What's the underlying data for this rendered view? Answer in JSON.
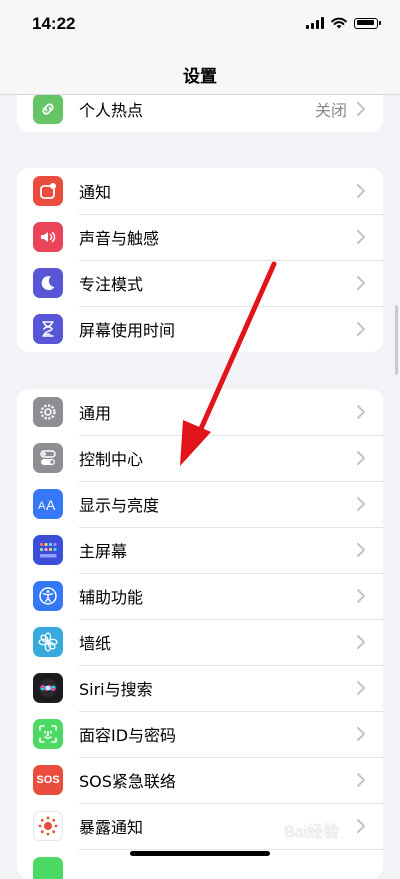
{
  "status_bar": {
    "time": "14:22"
  },
  "header": {
    "title": "设置"
  },
  "groups": [
    {
      "items": [
        {
          "label": "个人热点",
          "value": "关闭",
          "icon": "hotspot-icon",
          "color": "#65c466"
        }
      ]
    },
    {
      "items": [
        {
          "label": "通知",
          "icon": "notification-icon",
          "color": "#eb4d3d"
        },
        {
          "label": "声音与触感",
          "icon": "sound-icon",
          "color": "#eb445a"
        },
        {
          "label": "专注模式",
          "icon": "moon-icon",
          "color": "#5856d6"
        },
        {
          "label": "屏幕使用时间",
          "icon": "hourglass-icon",
          "color": "#5856d6"
        }
      ]
    },
    {
      "items": [
        {
          "label": "通用",
          "icon": "gear-icon",
          "color": "#8e8e93"
        },
        {
          "label": "控制中心",
          "icon": "toggles-icon",
          "color": "#8e8e93"
        },
        {
          "label": "显示与亮度",
          "icon": "text-size-icon",
          "color": "#3478f6"
        },
        {
          "label": "主屏幕",
          "icon": "home-grid-icon",
          "color": "#3a4ed8"
        },
        {
          "label": "辅助功能",
          "icon": "accessibility-icon",
          "color": "#3478f6"
        },
        {
          "label": "墙纸",
          "icon": "wallpaper-flower-icon",
          "color": "#36aadc"
        },
        {
          "label": "Siri与搜索",
          "icon": "siri-icon",
          "color": "#1c1c1e"
        },
        {
          "label": "面容ID与密码",
          "icon": "face-id-icon",
          "color": "#4cd964"
        },
        {
          "label": "SOS紧急联络",
          "icon": "sos-icon",
          "color": "#eb4d3d",
          "icon_text": "SOS"
        },
        {
          "label": "暴露通知",
          "icon": "exposure-icon",
          "color": "#ffffff"
        }
      ]
    }
  ],
  "watermark": {
    "text": "Bai经验"
  },
  "annotation": {
    "arrow_color": "#e0141a"
  }
}
